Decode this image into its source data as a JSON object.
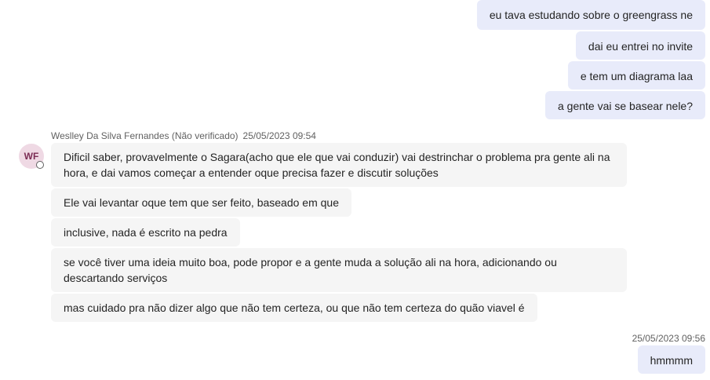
{
  "outgoing_top": [
    "eu tava estudando sobre o greengrass ne",
    "dai eu entrei no invite",
    "e tem um diagrama laa",
    "a gente vai se basear nele?"
  ],
  "incoming": {
    "sender": "Weslley Da Silva Fernandes (Não verificado)",
    "timestamp": "25/05/2023 09:54",
    "avatar_initials": "WF",
    "avatar_color": "#efd9e4",
    "messages": [
      "Dificil saber, provavelmente o Sagara(acho que ele que vai conduzir) vai destrinchar o problema pra gente ali na hora, e dai vamos começar a entender oque precisa fazer e discutir soluções",
      "Ele vai levantar oque tem que ser feito, baseado em que",
      "inclusive, nada é escrito na pedra",
      "se você tiver uma ideia muito boa, pode propor e a gente muda a solução ali na hora, adicionando ou descartando serviços",
      "mas cuidado pra não dizer algo que não tem certeza, ou que não tem certeza do quão viavel é"
    ]
  },
  "outgoing_bottom": {
    "timestamp": "25/05/2023 09:56",
    "message": "hmmmm"
  },
  "colors": {
    "outgoing_bubble": "#e8ebfa",
    "incoming_bubble": "#f5f5f5"
  }
}
